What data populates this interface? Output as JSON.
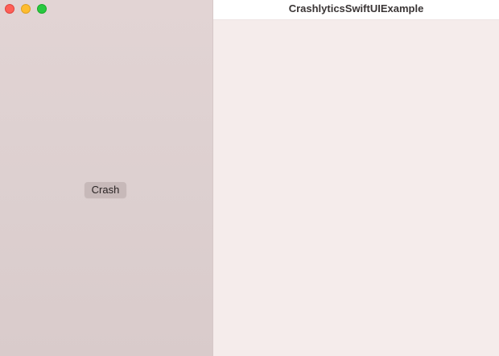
{
  "window": {
    "title": "CrashlyticsSwiftUIExample"
  },
  "sidebar": {
    "crash_button_label": "Crash"
  },
  "colors": {
    "sidebar_bg": "#ddd0d0",
    "detail_bg": "#f5eceb",
    "button_bg": "#c7b9b9",
    "close": "#fe5f57",
    "minimize": "#febc2e",
    "zoom": "#28c840"
  }
}
